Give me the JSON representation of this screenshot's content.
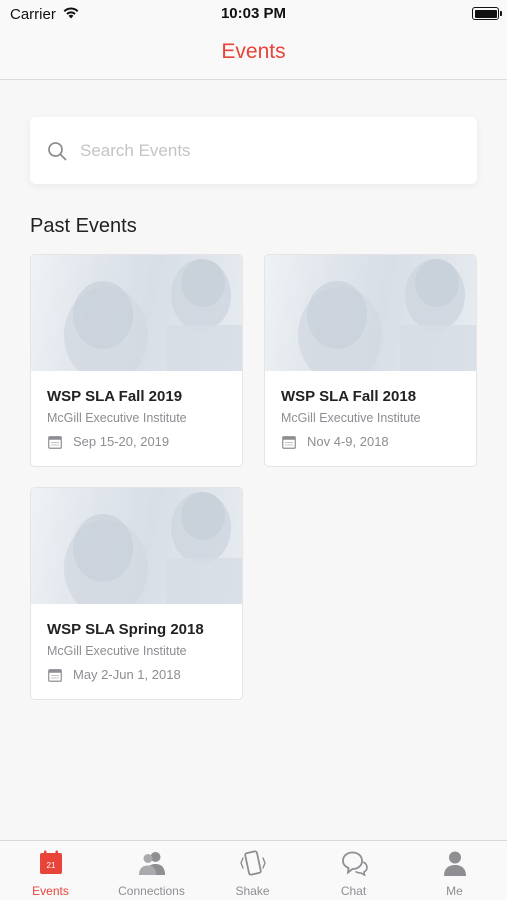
{
  "status_bar": {
    "carrier": "Carrier",
    "time": "10:03 PM"
  },
  "nav": {
    "title": "Events"
  },
  "search": {
    "placeholder": "Search Events",
    "value": ""
  },
  "section": {
    "title": "Past Events"
  },
  "events": [
    {
      "title": "WSP SLA Fall 2019",
      "venue": "McGill Executive Institute",
      "date": "Sep 15-20, 2019"
    },
    {
      "title": "WSP SLA Fall 2018",
      "venue": "McGill Executive Institute",
      "date": "Nov 4-9, 2018"
    },
    {
      "title": "WSP SLA Spring 2018",
      "venue": "McGill Executive Institute",
      "date": "May 2-Jun 1, 2018"
    }
  ],
  "tabs": [
    {
      "label": "Events",
      "icon": "calendar-icon",
      "badge": "21",
      "active": true
    },
    {
      "label": "Connections",
      "icon": "people-icon",
      "active": false
    },
    {
      "label": "Shake",
      "icon": "phone-shake-icon",
      "active": false
    },
    {
      "label": "Chat",
      "icon": "chat-bubbles-icon",
      "active": false
    },
    {
      "label": "Me",
      "icon": "person-icon",
      "active": false
    }
  ],
  "colors": {
    "accent": "#e8443a",
    "inactive": "#8e8e93",
    "background": "#f7f7f7"
  }
}
